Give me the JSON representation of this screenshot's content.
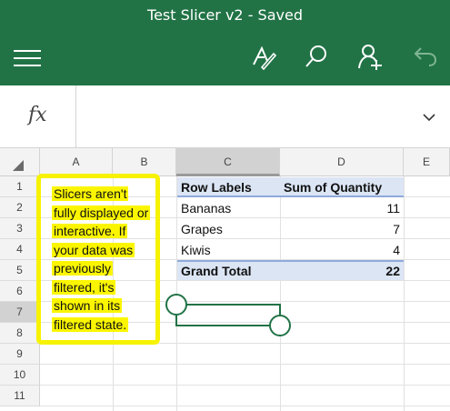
{
  "app": {
    "title": "Test Slicer v2 - Saved",
    "accent": "#217346",
    "icons": [
      "hamburger-menu-icon",
      "draw-pen-icon",
      "search-icon",
      "share-person-icon",
      "undo-icon"
    ]
  },
  "formula_bar": {
    "fx_label": "fx",
    "value": ""
  },
  "columns": [
    "A",
    "B",
    "C",
    "D",
    "E"
  ],
  "rows": [
    "1",
    "2",
    "3",
    "4",
    "5",
    "6",
    "7",
    "8",
    "9",
    "10",
    "11"
  ],
  "selected_column": "C",
  "selected_row": "7",
  "annotation": {
    "lines": [
      "Slicers aren't",
      "fully displayed or",
      "interactive. If",
      "your data was",
      "previously",
      "filtered, it's",
      "shown in its",
      "filtered state."
    ],
    "highlight_color": "#f6f200"
  },
  "pivot": {
    "header": {
      "row_labels": "Row Labels",
      "sum_label": "Sum of Quantity"
    },
    "rows": [
      {
        "label": "Bananas",
        "value": "11"
      },
      {
        "label": "Grapes",
        "value": "7"
      },
      {
        "label": "Kiwis",
        "value": "4"
      }
    ],
    "total": {
      "label": "Grand Total",
      "value": "22"
    }
  }
}
